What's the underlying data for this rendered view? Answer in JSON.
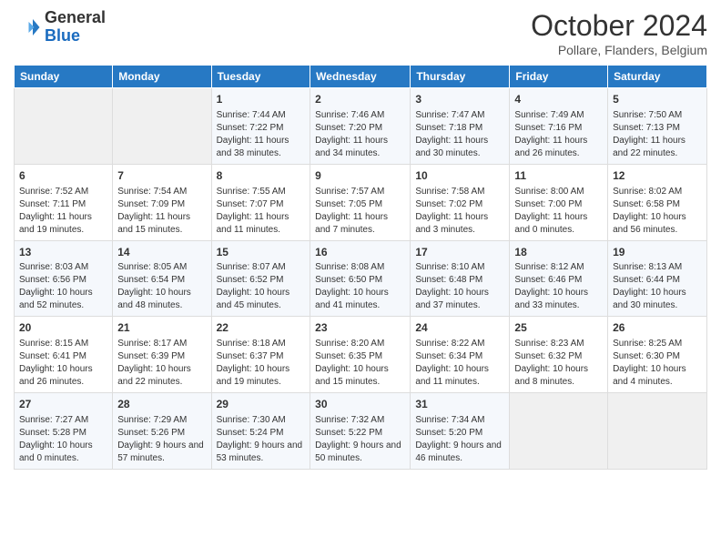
{
  "header": {
    "logo_general": "General",
    "logo_blue": "Blue",
    "title": "October 2024",
    "subtitle": "Pollare, Flanders, Belgium"
  },
  "days_of_week": [
    "Sunday",
    "Monday",
    "Tuesday",
    "Wednesday",
    "Thursday",
    "Friday",
    "Saturday"
  ],
  "weeks": [
    [
      {
        "day": "",
        "info": ""
      },
      {
        "day": "",
        "info": ""
      },
      {
        "day": "1",
        "info": "Sunrise: 7:44 AM\nSunset: 7:22 PM\nDaylight: 11 hours and 38 minutes."
      },
      {
        "day": "2",
        "info": "Sunrise: 7:46 AM\nSunset: 7:20 PM\nDaylight: 11 hours and 34 minutes."
      },
      {
        "day": "3",
        "info": "Sunrise: 7:47 AM\nSunset: 7:18 PM\nDaylight: 11 hours and 30 minutes."
      },
      {
        "day": "4",
        "info": "Sunrise: 7:49 AM\nSunset: 7:16 PM\nDaylight: 11 hours and 26 minutes."
      },
      {
        "day": "5",
        "info": "Sunrise: 7:50 AM\nSunset: 7:13 PM\nDaylight: 11 hours and 22 minutes."
      }
    ],
    [
      {
        "day": "6",
        "info": "Sunrise: 7:52 AM\nSunset: 7:11 PM\nDaylight: 11 hours and 19 minutes."
      },
      {
        "day": "7",
        "info": "Sunrise: 7:54 AM\nSunset: 7:09 PM\nDaylight: 11 hours and 15 minutes."
      },
      {
        "day": "8",
        "info": "Sunrise: 7:55 AM\nSunset: 7:07 PM\nDaylight: 11 hours and 11 minutes."
      },
      {
        "day": "9",
        "info": "Sunrise: 7:57 AM\nSunset: 7:05 PM\nDaylight: 11 hours and 7 minutes."
      },
      {
        "day": "10",
        "info": "Sunrise: 7:58 AM\nSunset: 7:02 PM\nDaylight: 11 hours and 3 minutes."
      },
      {
        "day": "11",
        "info": "Sunrise: 8:00 AM\nSunset: 7:00 PM\nDaylight: 11 hours and 0 minutes."
      },
      {
        "day": "12",
        "info": "Sunrise: 8:02 AM\nSunset: 6:58 PM\nDaylight: 10 hours and 56 minutes."
      }
    ],
    [
      {
        "day": "13",
        "info": "Sunrise: 8:03 AM\nSunset: 6:56 PM\nDaylight: 10 hours and 52 minutes."
      },
      {
        "day": "14",
        "info": "Sunrise: 8:05 AM\nSunset: 6:54 PM\nDaylight: 10 hours and 48 minutes."
      },
      {
        "day": "15",
        "info": "Sunrise: 8:07 AM\nSunset: 6:52 PM\nDaylight: 10 hours and 45 minutes."
      },
      {
        "day": "16",
        "info": "Sunrise: 8:08 AM\nSunset: 6:50 PM\nDaylight: 10 hours and 41 minutes."
      },
      {
        "day": "17",
        "info": "Sunrise: 8:10 AM\nSunset: 6:48 PM\nDaylight: 10 hours and 37 minutes."
      },
      {
        "day": "18",
        "info": "Sunrise: 8:12 AM\nSunset: 6:46 PM\nDaylight: 10 hours and 33 minutes."
      },
      {
        "day": "19",
        "info": "Sunrise: 8:13 AM\nSunset: 6:44 PM\nDaylight: 10 hours and 30 minutes."
      }
    ],
    [
      {
        "day": "20",
        "info": "Sunrise: 8:15 AM\nSunset: 6:41 PM\nDaylight: 10 hours and 26 minutes."
      },
      {
        "day": "21",
        "info": "Sunrise: 8:17 AM\nSunset: 6:39 PM\nDaylight: 10 hours and 22 minutes."
      },
      {
        "day": "22",
        "info": "Sunrise: 8:18 AM\nSunset: 6:37 PM\nDaylight: 10 hours and 19 minutes."
      },
      {
        "day": "23",
        "info": "Sunrise: 8:20 AM\nSunset: 6:35 PM\nDaylight: 10 hours and 15 minutes."
      },
      {
        "day": "24",
        "info": "Sunrise: 8:22 AM\nSunset: 6:34 PM\nDaylight: 10 hours and 11 minutes."
      },
      {
        "day": "25",
        "info": "Sunrise: 8:23 AM\nSunset: 6:32 PM\nDaylight: 10 hours and 8 minutes."
      },
      {
        "day": "26",
        "info": "Sunrise: 8:25 AM\nSunset: 6:30 PM\nDaylight: 10 hours and 4 minutes."
      }
    ],
    [
      {
        "day": "27",
        "info": "Sunrise: 7:27 AM\nSunset: 5:28 PM\nDaylight: 10 hours and 0 minutes."
      },
      {
        "day": "28",
        "info": "Sunrise: 7:29 AM\nSunset: 5:26 PM\nDaylight: 9 hours and 57 minutes."
      },
      {
        "day": "29",
        "info": "Sunrise: 7:30 AM\nSunset: 5:24 PM\nDaylight: 9 hours and 53 minutes."
      },
      {
        "day": "30",
        "info": "Sunrise: 7:32 AM\nSunset: 5:22 PM\nDaylight: 9 hours and 50 minutes."
      },
      {
        "day": "31",
        "info": "Sunrise: 7:34 AM\nSunset: 5:20 PM\nDaylight: 9 hours and 46 minutes."
      },
      {
        "day": "",
        "info": ""
      },
      {
        "day": "",
        "info": ""
      }
    ]
  ]
}
